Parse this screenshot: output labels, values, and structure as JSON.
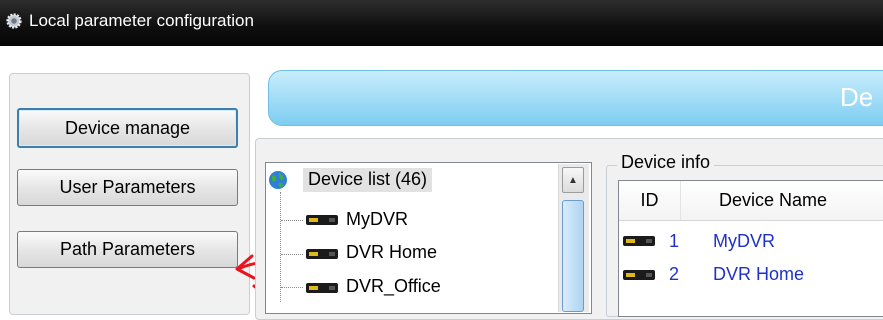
{
  "window": {
    "title": "Local parameter configuration"
  },
  "sidebar": {
    "buttons": [
      {
        "label": "Device manage"
      },
      {
        "label": "User Parameters"
      },
      {
        "label": "Path Parameters"
      }
    ]
  },
  "banner": {
    "text": "De"
  },
  "device_tree": {
    "root_label": "Device list (46)",
    "items": [
      {
        "label": "MyDVR"
      },
      {
        "label": "DVR Home"
      },
      {
        "label": "DVR_Office"
      }
    ]
  },
  "device_info": {
    "title": "Device info",
    "columns": [
      "ID",
      "Device Name"
    ],
    "rows": [
      {
        "id": "1",
        "name": "MyDVR"
      },
      {
        "id": "2",
        "name": "DVR Home"
      }
    ]
  },
  "colors": {
    "title_bar": "#101010",
    "banner": "#7ecdf2",
    "link_text": "#1f32c8",
    "annotation_arrow": "#e8141e"
  }
}
